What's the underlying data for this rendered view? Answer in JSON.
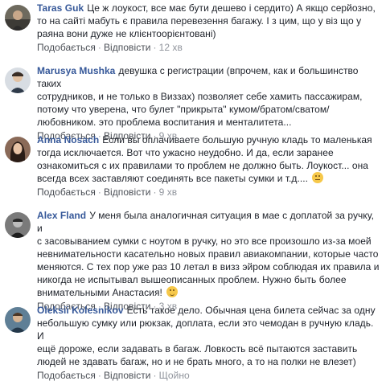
{
  "comments": [
    {
      "author": "Taras Guk",
      "text_lines": [
        "Це ж лоукост, все має бути дешево і сердито) А якщо серйозно,",
        "то на сайті мабуть є правила перевезення багажу. І з цим, що у віз що у",
        "раяна вони дуже не клієнтоорієнтовані)"
      ],
      "actions": [
        "Подобається",
        "Відповісти"
      ],
      "time": "12 хв"
    },
    {
      "author": "Marusya Mushka",
      "text_lines": [
        "девушка с регистрации (впрочем, как и большинство таких",
        "сотрудников, и не только в Виззах) позволяет себе хамить пассажирам,",
        "потому что уверена, что булет \"прикрыта\" кумом/братом/сватом/",
        "любовником. это проблема воспитания и менталитета..."
      ],
      "actions": [
        "Подобається",
        "Відповісти"
      ],
      "time": "9 хв"
    },
    {
      "author": "Anna Nosach",
      "text_lines": [
        "Если вы оплачиваете большую ручную кладь то маленькая",
        "тогда исключается. Вот что ужасно неудобно. И да, если заранее",
        "ознакомиться с их правилами то проблем не должно быть. Лоукост... она",
        "всегда всех заставляют соединять все пакеты сумки и т.д...."
      ],
      "emoji": "tired-face",
      "actions": [
        "Подобається",
        "Відповісти"
      ],
      "time": "9 хв"
    },
    {
      "author": "Alex Fland",
      "text_lines": [
        "У меня была аналогичная ситуация в мае с доплатой за ручку, и",
        "с засовыванием сумки с ноутом в ручку, но это все произошло из-за моей",
        "невнимательности касательно новых правил авиакомпании, которые часто",
        "меняются. С тех пор уже раз 10 летал в визз эйром соблюдая их правила и",
        "никогда не испытывал вышеописанных проблем. Нужно быть более",
        "внимательными Анастасия!"
      ],
      "emoji": "smile",
      "actions": [
        "Подобається",
        "Відповісти"
      ],
      "time": "3 хв"
    },
    {
      "author": "Oleksii Kolesnikov",
      "text_lines": [
        "Есть такое дело. Обычная цена билета сейчас за одну",
        "небольшую сумку или рюкзак, доплата, если это чемодан в ручную кладь. И",
        "ещё дороже, если задавать в багаж. Ловкость всё пытаются заставить",
        "людей не здавать багаж, но и не брать много, а то на полки не влезет)"
      ],
      "actions": [
        "Подобається",
        "Відповісти"
      ],
      "time": "Щойно"
    }
  ],
  "colors": {
    "author": "#365899",
    "text": "#1d2129",
    "meta": "#90949c",
    "action": "#4b4f56"
  }
}
